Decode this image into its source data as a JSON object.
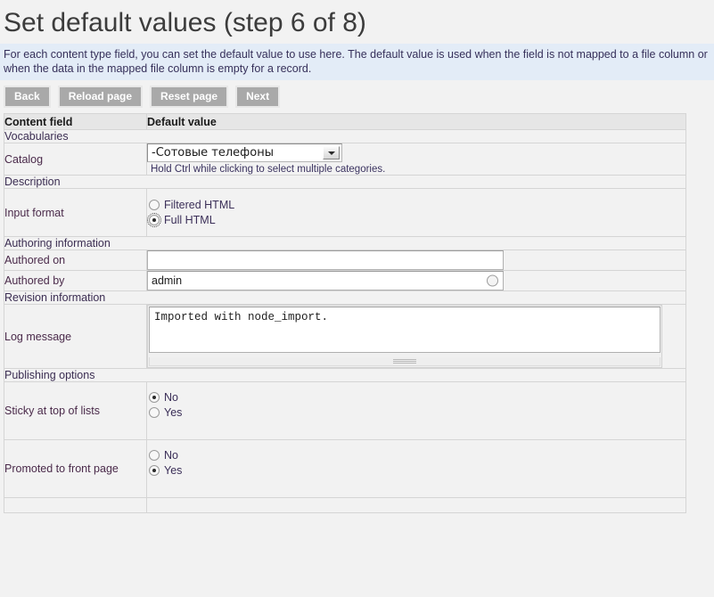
{
  "page": {
    "title": "Set default values (step 6 of 8)",
    "help_text": "For each content type field, you can set the default value to use here. The default value is used when the field is not mapped to a file column or when the data in the mapped file column is empty for a record."
  },
  "buttons": {
    "back": "Back",
    "reload": "Reload page",
    "reset": "Reset page",
    "next": "Next"
  },
  "table": {
    "headers": {
      "field": "Content field",
      "value": "Default value"
    },
    "sections": {
      "vocabularies": "Vocabularies",
      "description": "Description",
      "authoring": "Authoring information",
      "revision": "Revision information",
      "publishing": "Publishing options"
    },
    "rows": {
      "catalog": {
        "label": "Catalog",
        "selected": "-Сотовые телефоны",
        "description": "Hold Ctrl while clicking to select multiple categories."
      },
      "input_format": {
        "label": "Input format",
        "options": [
          {
            "label": "Filtered HTML",
            "checked": false
          },
          {
            "label": "Full HTML",
            "checked": true
          }
        ]
      },
      "authored_on": {
        "label": "Authored on",
        "value": ""
      },
      "authored_by": {
        "label": "Authored by",
        "value": "admin"
      },
      "log_message": {
        "label": "Log message",
        "value": "Imported with node_import."
      },
      "sticky": {
        "label": "Sticky at top of lists",
        "options": [
          {
            "label": "No",
            "checked": true
          },
          {
            "label": "Yes",
            "checked": false
          }
        ]
      },
      "promoted": {
        "label": "Promoted to front page",
        "options": [
          {
            "label": "No",
            "checked": false
          },
          {
            "label": "Yes",
            "checked": true
          }
        ]
      }
    }
  },
  "colors": {
    "help_banner_bg": "#e3ecf7",
    "button_bg": "#a9a9a9",
    "table_header_bg": "#e6e6e6",
    "label_text": "#4a2a4a"
  }
}
